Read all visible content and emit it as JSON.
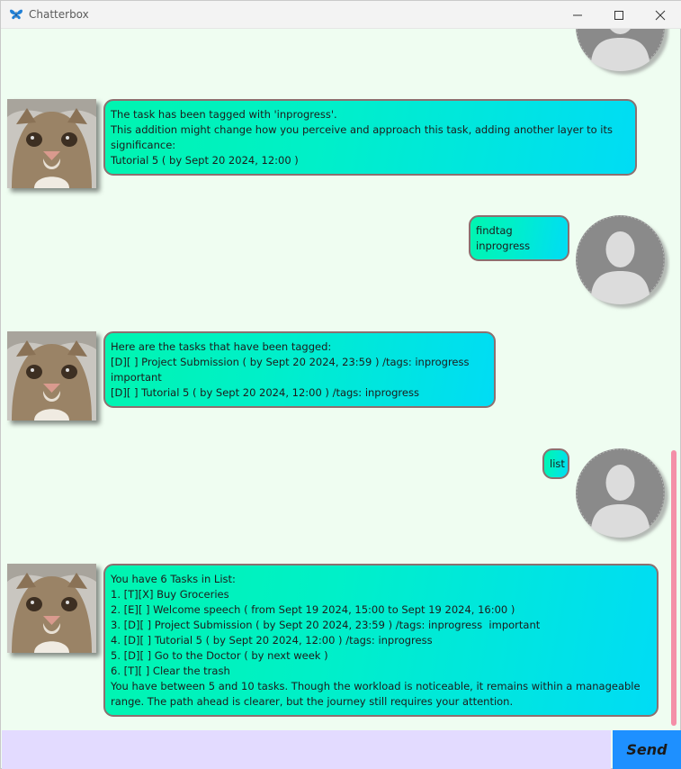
{
  "window": {
    "title": "Chatterbox",
    "icon": "butterfly-icon"
  },
  "messages": [
    {
      "sender": "user",
      "lines": []
    },
    {
      "sender": "bot",
      "text": "The task has been tagged with 'inprogress'.\nThis addition might change how you perceive and approach this task, adding another layer to its significance:\nTutorial 5 ( by Sept 20 2024, 12:00 )"
    },
    {
      "sender": "user",
      "text": "findtag inprogress"
    },
    {
      "sender": "bot",
      "text": "Here are the tasks that have been tagged:\n[D][ ] Project Submission ( by Sept 20 2024, 23:59 ) /tags: inprogress  important\n[D][ ] Tutorial 5 ( by Sept 20 2024, 12:00 ) /tags: inprogress"
    },
    {
      "sender": "user",
      "text": "list"
    },
    {
      "sender": "bot",
      "text": "You have 6 Tasks in List:\n1. [T][X] Buy Groceries\n2. [E][ ] Welcome speech ( from Sept 19 2024, 15:00 to Sept 19 2024, 16:00 )\n3. [D][ ] Project Submission ( by Sept 20 2024, 23:59 ) /tags: inprogress  important\n4. [D][ ] Tutorial 5 ( by Sept 20 2024, 12:00 ) /tags: inprogress\n5. [D][ ] Go to the Doctor ( by next week )\n6. [T][ ] Clear the trash\nYou have between 5 and 10 tasks. Though the workload is noticeable, it remains within a manageable range. The path ahead is clearer, but the journey still requires your attention."
    }
  ],
  "input": {
    "value": "",
    "placeholder": ""
  },
  "send_label": "Send",
  "colors": {
    "chat_background": "#effdf1",
    "bubble_start": "#00f5b0",
    "bubble_end": "#00dcf5",
    "bubble_border": "#8d6f6f",
    "input_background": "#e3dbff",
    "send_button": "#1e90ff",
    "scrollbar": "#f48fa8"
  }
}
